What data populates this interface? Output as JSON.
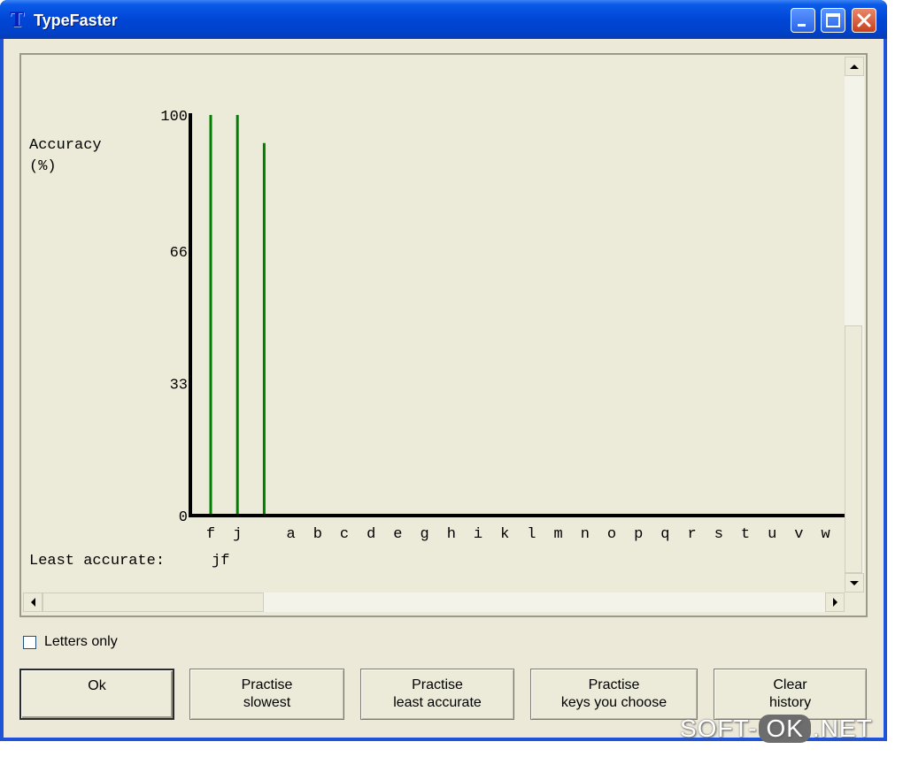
{
  "window": {
    "title": "TypeFaster",
    "app_icon": "T",
    "controls": [
      "minimize-icon",
      "maximize-icon",
      "close-icon"
    ]
  },
  "chart_data": {
    "type": "bar",
    "title": "",
    "ylabel_line1": "Accuracy",
    "ylabel_line2": "(%)",
    "yticks": [
      "100",
      "66",
      "33",
      "0"
    ],
    "ylim": [
      0,
      100
    ],
    "categories": [
      "f",
      "j",
      "",
      "a",
      "b",
      "c",
      "d",
      "e",
      "g",
      "h",
      "i",
      "k",
      "l",
      "m",
      "n",
      "o",
      "p",
      "q",
      "r",
      "s",
      "t",
      "u",
      "v",
      "w"
    ],
    "values": [
      100,
      100,
      93,
      null,
      null,
      null,
      null,
      null,
      null,
      null,
      null,
      null,
      null,
      null,
      null,
      null,
      null,
      null,
      null,
      null,
      null,
      null,
      null,
      null
    ],
    "bar_color": "#008000",
    "grid": false
  },
  "summary": {
    "label": "Least accurate:",
    "value": "jf"
  },
  "options": {
    "letters_only_label": "Letters only",
    "letters_only_checked": false
  },
  "buttons": {
    "ok": "Ok",
    "slowest_l1": "Practise",
    "slowest_l2": "slowest",
    "least_l1": "Practise",
    "least_l2": "least accurate",
    "choose_l1": "Practise",
    "choose_l2": "keys you choose",
    "clear_l1": "Clear",
    "clear_l2": "history"
  },
  "watermark": {
    "left": "SOFT-",
    "mid": "OK",
    "right": ".NET"
  }
}
